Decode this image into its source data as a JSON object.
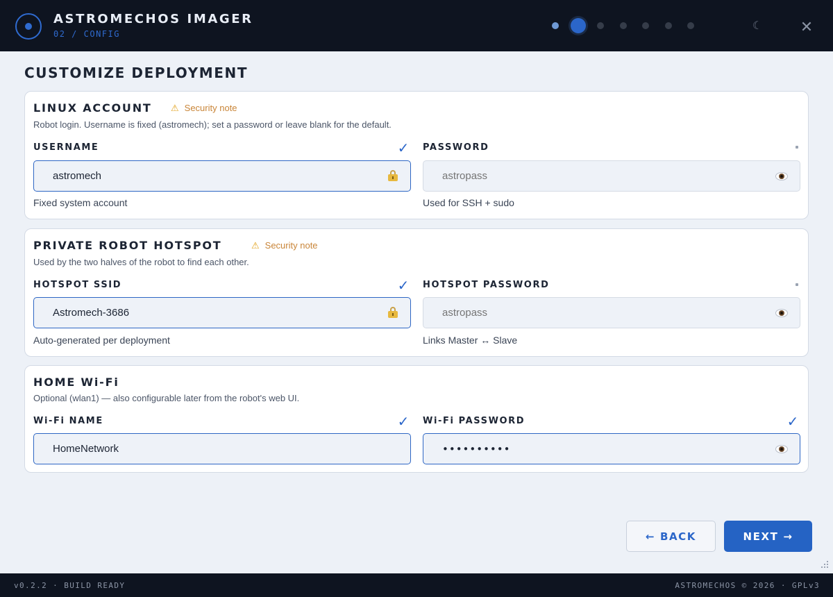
{
  "header": {
    "app_title": "ASTROMECHOS IMAGER",
    "subtitle": "02 / CONFIG",
    "steps": [
      "done",
      "current",
      "pending",
      "pending",
      "pending",
      "pending",
      "pending"
    ],
    "current_step": 2,
    "total_steps": 7,
    "theme_icon": "moon-icon",
    "theme_glyph": "☾",
    "close_icon": "close-icon",
    "close_glyph": "✕"
  },
  "page": {
    "title": "CUSTOMIZE DEPLOYMENT"
  },
  "linux_account": {
    "title": "LINUX ACCOUNT",
    "note_icon": "warning-icon",
    "note_glyph": "⚠",
    "note": "Security note",
    "description": "Robot login. Username is fixed (astromech); set a password or leave blank for the default.",
    "username_label": "USERNAME",
    "username_value": "astromech",
    "username_valid": "✓",
    "username_help": "Fixed system account",
    "password_label": "PASSWORD",
    "password_placeholder": "astropass",
    "password_help": "Used for SSH + sudo"
  },
  "hotspot": {
    "title": "PRIVATE ROBOT HOTSPOT",
    "note_glyph": "⚠",
    "note": "Security note",
    "description": "Used by the two halves of the robot to find each other.",
    "ssid_label": "HOTSPOT SSID",
    "ssid_value": "Astromech-3686",
    "ssid_valid": "✓",
    "ssid_help": "Auto-generated per deployment",
    "password_label": "HOTSPOT PASSWORD",
    "password_placeholder": "astropass",
    "password_help": "Links Master ↔ Slave"
  },
  "home_wifi": {
    "title": "HOME Wi-Fi",
    "description": "Optional (wlan1) — also configurable later from the robot's web UI.",
    "name_label": "Wi-Fi NAME",
    "name_value": "HomeNetwork",
    "name_valid": "✓",
    "password_label": "Wi-Fi PASSWORD",
    "password_value": "••••••••••",
    "password_valid": "✓"
  },
  "nav": {
    "back_label": "← BACK",
    "next_label": "NEXT →"
  },
  "status": {
    "left": "v0.2.2 · BUILD READY",
    "right": "ASTROMECHOS © 2026 · GPLv3"
  },
  "colors": {
    "accent": "#2563c4",
    "header_bg": "#0e1420",
    "warning": "#c98538",
    "page_bg": "#edf1f7"
  }
}
